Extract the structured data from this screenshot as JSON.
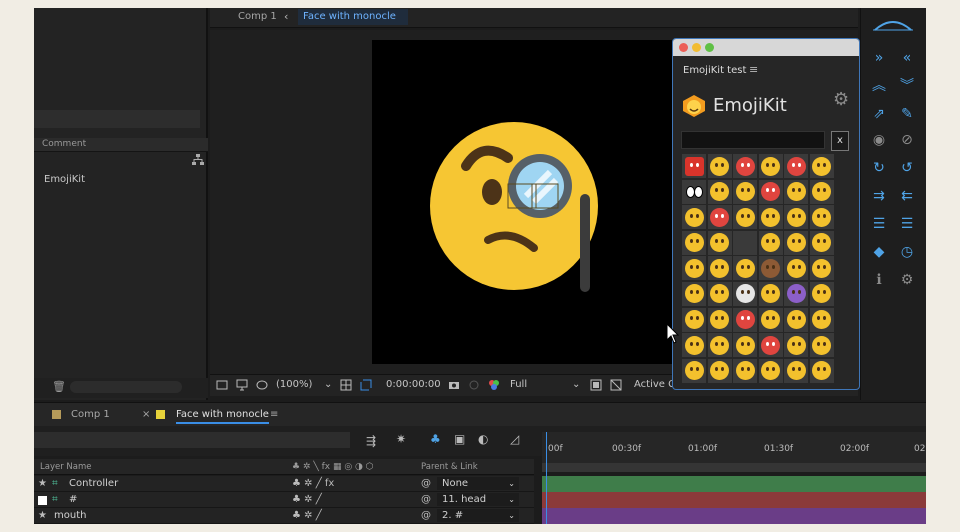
{
  "project": {
    "column_comment": "Comment",
    "item": "EmojiKit"
  },
  "comp_panel": {
    "tab1": "Comp 1",
    "arrow": "‹",
    "tab2": "Face with monocle"
  },
  "viewer_bar": {
    "zoom": "(100%)",
    "timecode": "0:00:00:00",
    "resolution": "Full",
    "camera": "Active C"
  },
  "emojikit": {
    "window_title": "EmojiKit test",
    "brand": "EmojiKit",
    "clear_label": "x",
    "grid": [
      [
        "t",
        "y",
        "r",
        "y",
        "r",
        "y"
      ],
      [
        "eyes",
        "y",
        "y",
        "r",
        "y",
        "y"
      ],
      [
        "y",
        "r",
        "y",
        "y",
        "y",
        "y"
      ],
      [
        "y",
        "y",
        "h",
        "y",
        "y",
        "y"
      ],
      [
        "y",
        "y",
        "y",
        "b",
        "y",
        "y"
      ],
      [
        "y",
        "y",
        "w",
        "y",
        "p",
        "y"
      ],
      [
        "y",
        "y",
        "r",
        "y",
        "y",
        "y"
      ],
      [
        "y",
        "y",
        "y",
        "r",
        "y",
        "y"
      ],
      [
        "y",
        "y",
        "y",
        "y",
        "y",
        "y"
      ]
    ]
  },
  "timeline": {
    "tab1": "Comp 1",
    "tab2": "Face with monocle",
    "col_layer_name": "Layer Name",
    "col_parent": "Parent & Link",
    "ruler": [
      "00f",
      "00:30f",
      "01:00f",
      "01:30f",
      "02:00f",
      "02"
    ],
    "layers": [
      {
        "name": "Controller",
        "parent": "None"
      },
      {
        "name": "#",
        "parent": "11. head"
      },
      {
        "name": "mouth",
        "parent": "2. #"
      }
    ]
  },
  "colors": {
    "accent_blue": "#3a8ee6",
    "comp1_swatch": "#b59a5a",
    "face_swatch": "#e6d23a",
    "track_green": "#3f7d4a",
    "track_red": "#8b3a3a",
    "track_purple": "#6a3d87"
  }
}
